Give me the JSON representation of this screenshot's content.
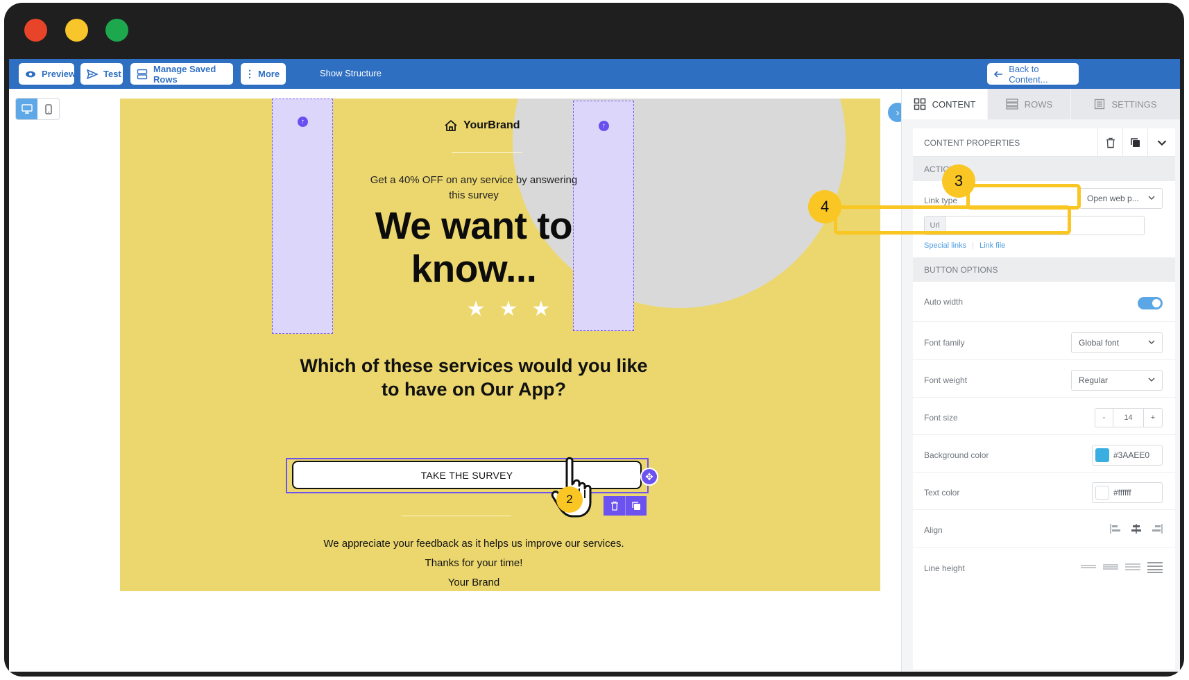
{
  "toolbar": {
    "preview": "Preview",
    "test": "Test",
    "manage_saved_rows": "Manage Saved Rows",
    "more": "More",
    "show_structure": "Show Structure",
    "back_to_content": "Back to Content..."
  },
  "email": {
    "brand": "YourBrand",
    "offer": "Get a 40% OFF on any service by answering this survey",
    "headline": "We want to know...",
    "question": "Which of these services would you like to have on Our App?",
    "button_label": "TAKE THE SURVEY",
    "footer_line1": "We appreciate your feedback as it helps us improve our services.",
    "footer_line2": "Thanks for your time!",
    "footer_line3": "Your Brand",
    "background_color": "#ECD76E"
  },
  "annotations": {
    "step2": "2",
    "step3": "3",
    "step4": "4"
  },
  "panel": {
    "tabs": [
      "CONTENT",
      "ROWS",
      "SETTINGS"
    ],
    "content_properties": "CONTENT PROPERTIES",
    "action_section": "ACTION",
    "link_type_label": "Link type",
    "link_type_value": "Open web p...",
    "url_label": "Url",
    "url_value": "",
    "special_links": "Special links",
    "link_file": "Link file",
    "button_options_section": "BUTTON OPTIONS",
    "auto_width_label": "Auto width",
    "font_family_label": "Font family",
    "font_family_value": "Global font",
    "font_weight_label": "Font weight",
    "font_weight_value": "Regular",
    "font_size_label": "Font size",
    "font_size_value": "14",
    "font_size_minus": "-",
    "font_size_plus": "+",
    "background_color_label": "Background color",
    "background_color_value": "#3AAEE0",
    "text_color_label": "Text color",
    "text_color_value": "#ffffff",
    "align_label": "Align",
    "line_height_label": "Line height"
  },
  "colors": {
    "toolbar": "#2F6FC2",
    "accent_purple": "#6C52EE",
    "highlight_yellow": "#F9C623"
  }
}
